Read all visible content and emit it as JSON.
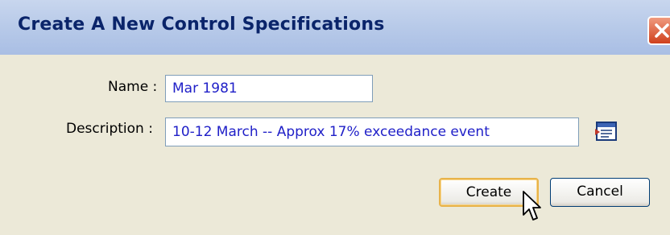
{
  "dialog": {
    "title": "Create A New Control Specifications",
    "close_icon": "close-x-icon"
  },
  "form": {
    "name_label": "Name :",
    "name_value": "Mar 1981",
    "description_label": "Description :",
    "description_value": "10-12 March -- Approx 17% exceedance event",
    "browse_icon": "text-editor-icon"
  },
  "buttons": {
    "create_label": "Create",
    "cancel_label": "Cancel"
  },
  "colors": {
    "title_text": "#0a246a",
    "titlebar": "#b9cbe9",
    "dialog_bg": "#ece9d8",
    "input_text": "#2020c8",
    "close_button": "#d0401c"
  }
}
